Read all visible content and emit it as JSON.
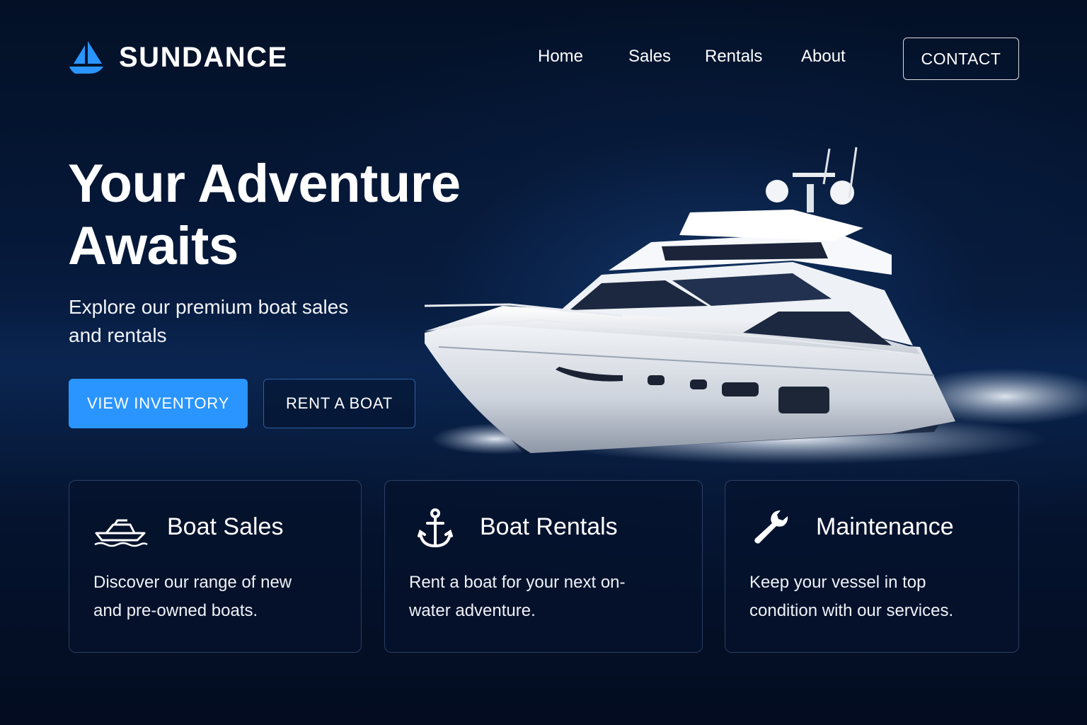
{
  "brand": {
    "name": "SUNDANCE",
    "logo_icon": "sailboat-icon",
    "accent": "#2a95ff"
  },
  "nav": {
    "items": [
      "Home",
      "Sales",
      "Rentals",
      "About"
    ],
    "contact_label": "CONTACT"
  },
  "hero": {
    "title_line1": "Your Adventure",
    "title_line2": "Awaits",
    "subtitle_line1": "Explore our premium boat sales",
    "subtitle_line2": "and rentals",
    "primary_cta": "VIEW INVENTORY",
    "secondary_cta": "RENT A BOAT",
    "image": "yacht-illustration"
  },
  "cards": [
    {
      "icon": "boat-icon",
      "title": "Boat Sales",
      "line1": "Discover our range of new",
      "line2": "and pre-owned boats."
    },
    {
      "icon": "anchor-icon",
      "title": "Boat Rentals",
      "line1": "Rent a boat for your next on-",
      "line2": "water adventure."
    },
    {
      "icon": "wrench-icon",
      "title": "Maintenance",
      "line1": "Keep your vessel in top",
      "line2": "condition with our services."
    }
  ]
}
